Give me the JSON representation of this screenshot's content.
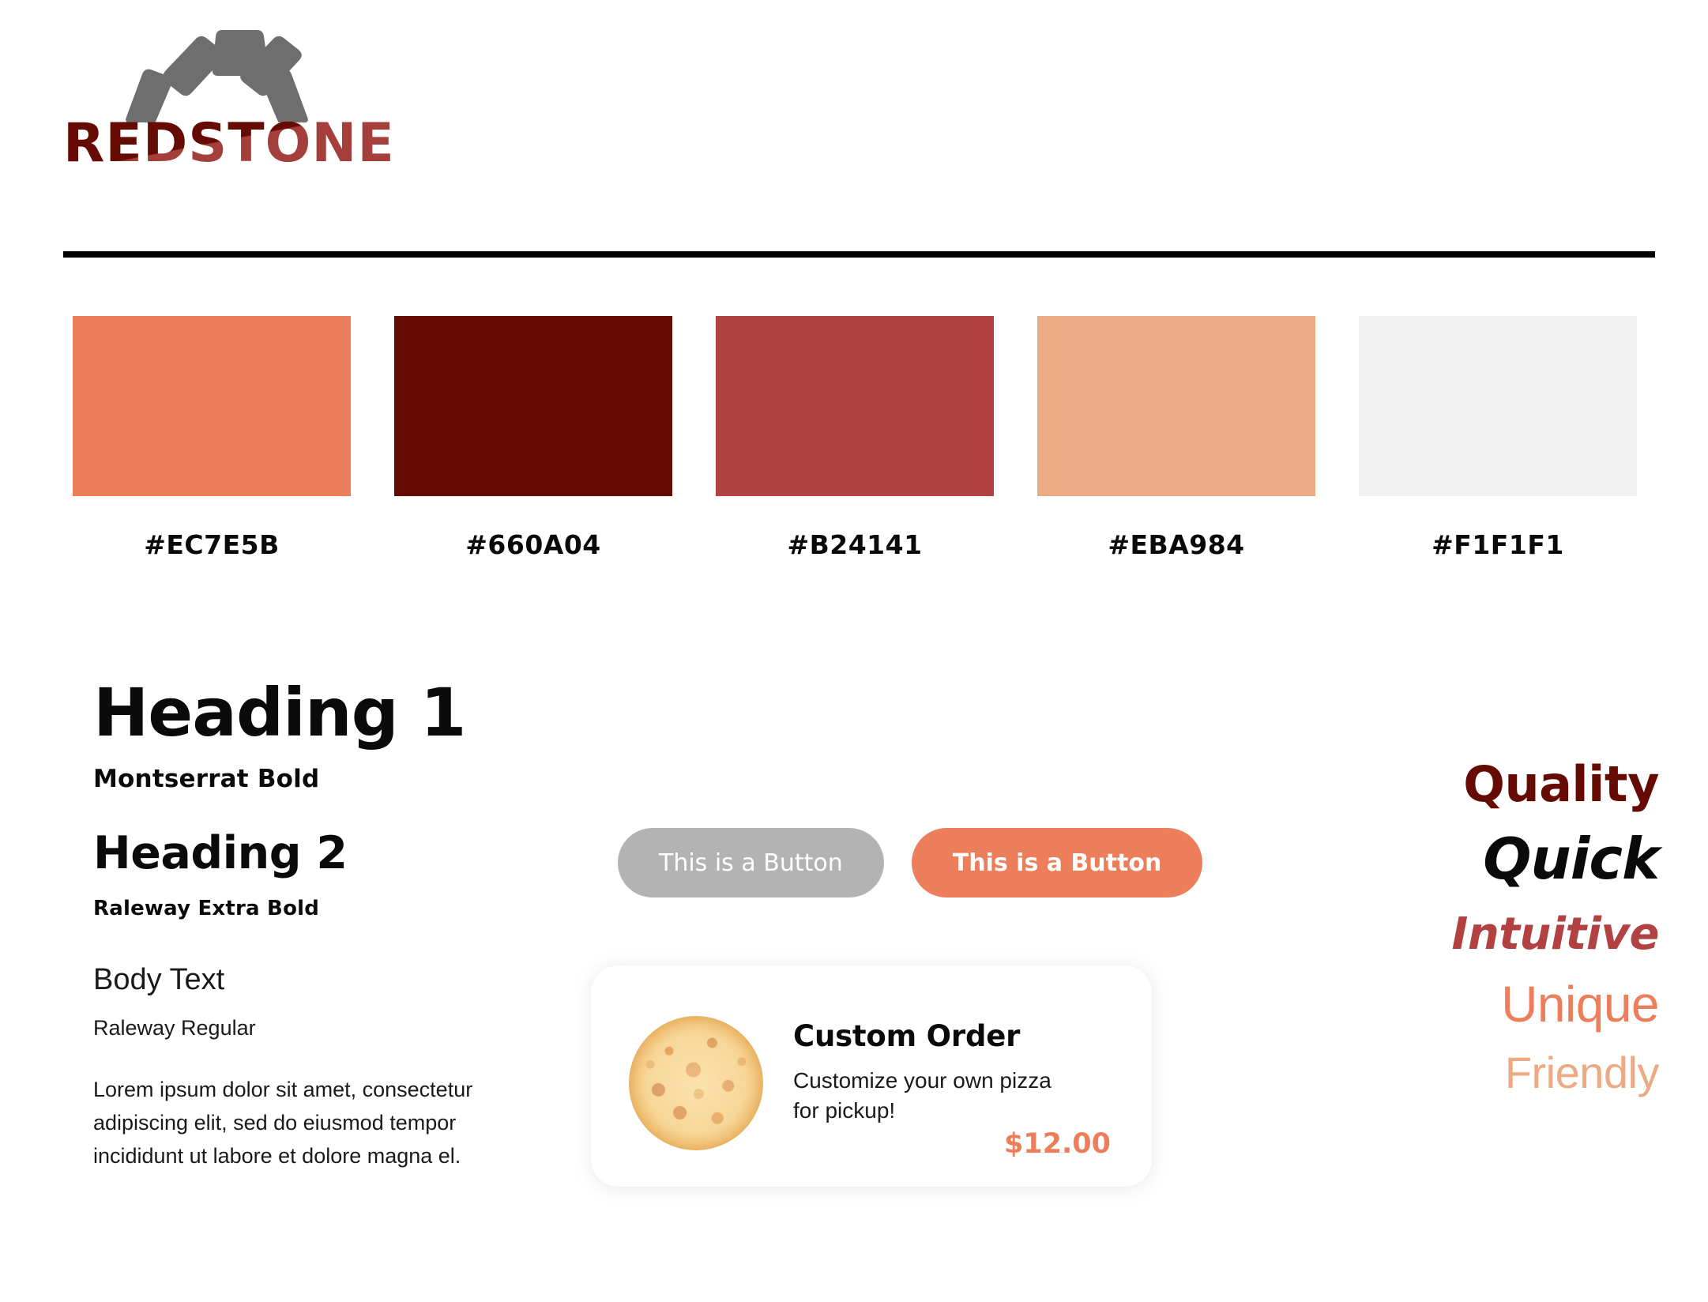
{
  "brand": {
    "name": "REDSTONE",
    "logo_icon": "stone-arch-icon",
    "logo_stone_color": "#6E6E6E",
    "wordmark_dark": "#660A04",
    "wordmark_light": "#A43F3C"
  },
  "palette": {
    "swatches": [
      {
        "hex": "#EC7E5B",
        "label": "#EC7E5B"
      },
      {
        "hex": "#660A04",
        "label": "#660A04"
      },
      {
        "hex": "#B24141",
        "label": "#B24141"
      },
      {
        "hex": "#EBA984",
        "label": "#EBA984"
      },
      {
        "hex": "#F1F1F1",
        "label": "#F1F1F1"
      }
    ]
  },
  "typography": {
    "h1_sample": "Heading 1",
    "h1_note": "Montserrat Bold",
    "h2_sample": "Heading 2",
    "h2_note": "Raleway Extra Bold",
    "body_sample": "Body Text",
    "body_note": "Raleway Regular",
    "body_paragraph": "Lorem ipsum dolor sit amet, consectetur adipiscing elit, sed do eiusmod tempor incididunt ut labore et dolore magna el."
  },
  "buttons": {
    "secondary_label": "This is a Button",
    "secondary_color": "#B3B3B3",
    "primary_label": "This is a Button",
    "primary_color": "#EC7E5B"
  },
  "product_card": {
    "image_icon": "pizza-icon",
    "title": "Custom Order",
    "description": "Customize your own pizza for pickup!",
    "price": "$12.00",
    "price_color": "#EC7E5B"
  },
  "adjectives": [
    {
      "word": "Quality",
      "color": "#660A04"
    },
    {
      "word": "Quick",
      "color": "#0A0A0A"
    },
    {
      "word": "Intuitive",
      "color": "#B24141"
    },
    {
      "word": "Unique",
      "color": "#EC7E5B"
    },
    {
      "word": "Friendly",
      "color": "#EBA984"
    }
  ]
}
